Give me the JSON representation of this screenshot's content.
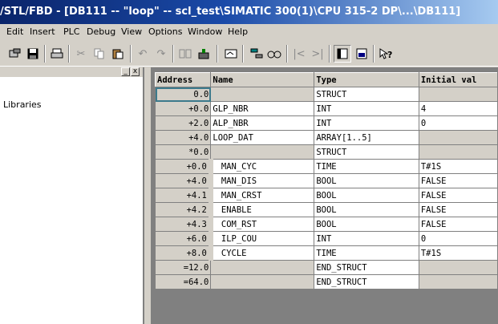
{
  "window": {
    "title": "/STL/FBD  - [DB111 -- \"loop\" -- scl_test\\SIMATIC 300(1)\\CPU 315-2 DP\\...\\DB111]"
  },
  "menu": [
    "Edit",
    "Insert",
    "PLC",
    "Debug",
    "View",
    "Options",
    "Window",
    "Help"
  ],
  "toolbar": {
    "icons": [
      "open-icon",
      "save-icon",
      "print-icon",
      "cut-icon",
      "copy-icon",
      "paste-icon",
      "undo-icon",
      "redo-icon",
      "compile-icon",
      "download-icon",
      "monitor-icon",
      "station-icon",
      "glasses-icon",
      "first-icon",
      "last-icon",
      "overview-icon",
      "details-icon",
      "help-icon"
    ]
  },
  "left_pane": {
    "close_label": "x",
    "min_label": "_",
    "libraries_label": "Libraries"
  },
  "table": {
    "headers": [
      "Address",
      "Name",
      "Type",
      "Initial val"
    ],
    "rows": [
      {
        "address": "0.0",
        "name": "",
        "type": "STRUCT",
        "initial": "",
        "indent": 0
      },
      {
        "address": "+0.0",
        "name": "GLP_NBR",
        "type": "INT",
        "initial": "4",
        "indent": 0
      },
      {
        "address": "+2.0",
        "name": "ALP_NBR",
        "type": "INT",
        "initial": "0",
        "indent": 0
      },
      {
        "address": "+4.0",
        "name": "LOOP_DAT",
        "type": "ARRAY[1..5]",
        "initial": "",
        "indent": 0
      },
      {
        "address": "*0.0",
        "name": "",
        "type": "STRUCT",
        "initial": "",
        "indent": 0
      },
      {
        "address": "+0.0",
        "name": "MAN_CYC",
        "type": "TIME",
        "initial": "T#1S",
        "indent": 1
      },
      {
        "address": "+4.0",
        "name": "MAN_DIS",
        "type": "BOOL",
        "initial": "FALSE",
        "indent": 1
      },
      {
        "address": "+4.1",
        "name": "MAN_CRST",
        "type": "BOOL",
        "initial": "FALSE",
        "indent": 1
      },
      {
        "address": "+4.2",
        "name": "ENABLE",
        "type": "BOOL",
        "initial": "FALSE",
        "indent": 1
      },
      {
        "address": "+4.3",
        "name": "COM_RST",
        "type": "BOOL",
        "initial": "FALSE",
        "indent": 1
      },
      {
        "address": "+6.0",
        "name": "ILP_COU",
        "type": "INT",
        "initial": "0",
        "indent": 1
      },
      {
        "address": "+8.0",
        "name": "CYCLE",
        "type": "TIME",
        "initial": "T#1S",
        "indent": 1
      },
      {
        "address": "=12.0",
        "name": "",
        "type": "END_STRUCT",
        "initial": "",
        "indent": 0
      },
      {
        "address": "=64.0",
        "name": "",
        "type": "END_STRUCT",
        "initial": "",
        "indent": 0
      }
    ]
  },
  "colors": {
    "title_bar": "#0a246a",
    "chrome": "#d4d0c8",
    "grid_background": "#808080"
  }
}
